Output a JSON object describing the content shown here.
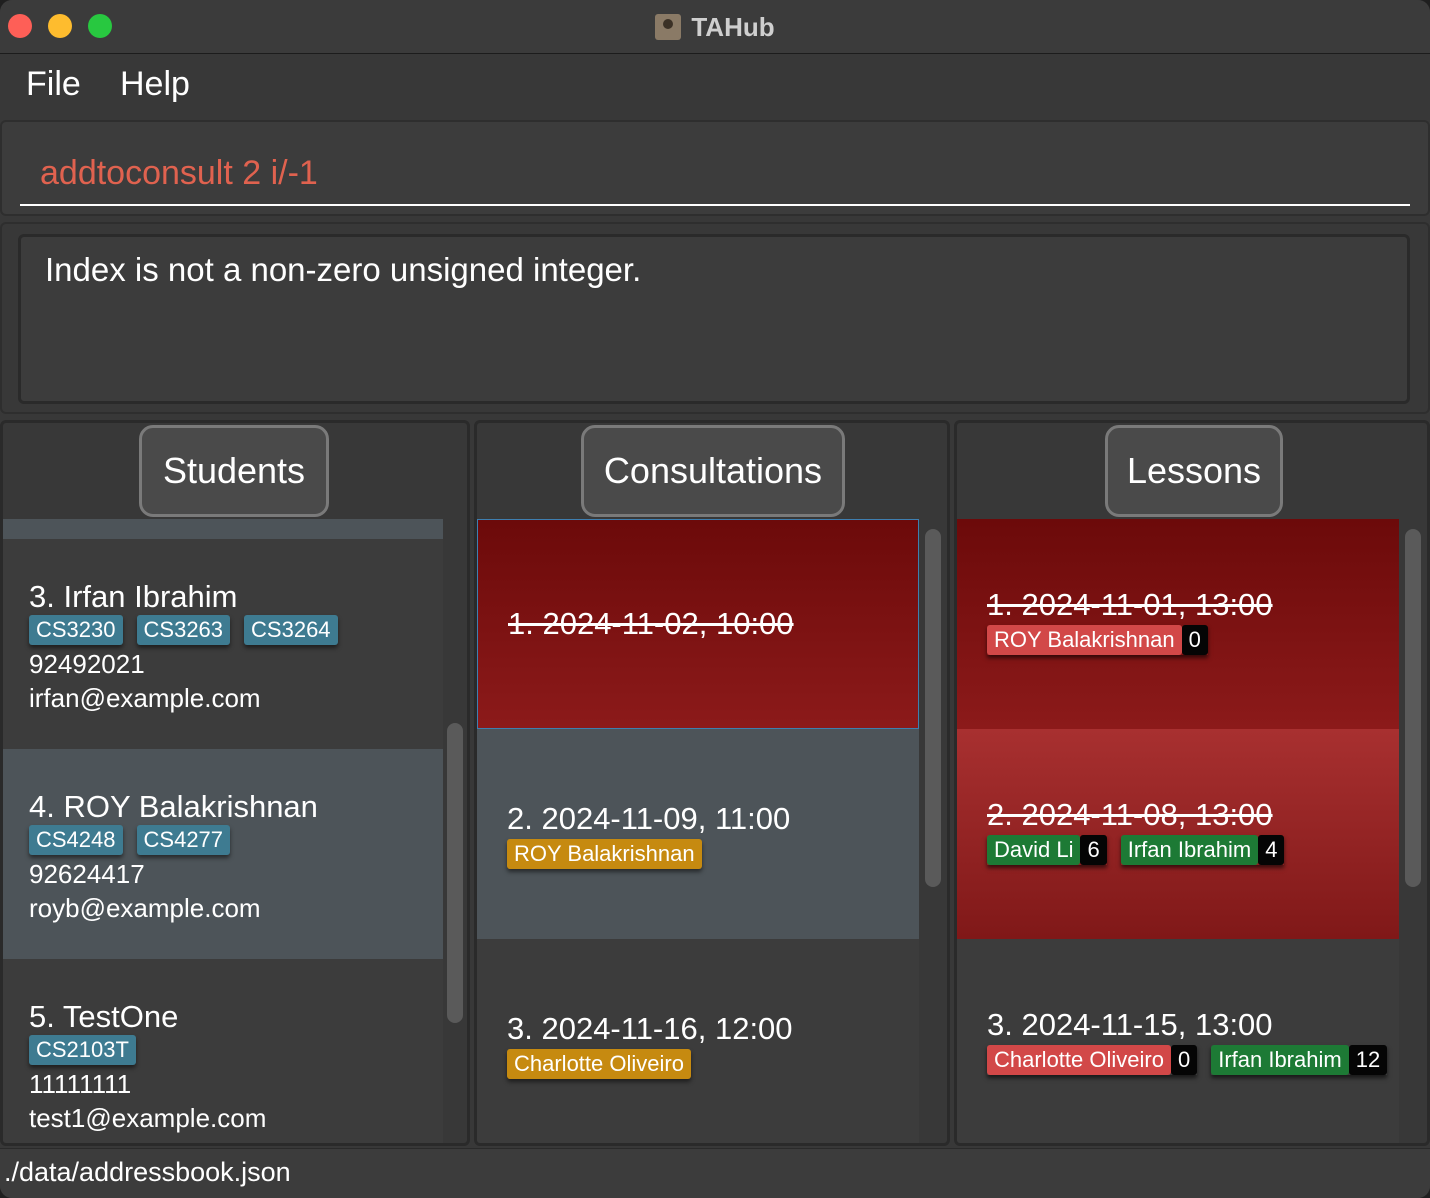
{
  "window": {
    "title": "TAHub"
  },
  "menu": {
    "file": "File",
    "help": "Help"
  },
  "command": {
    "value": "addtoconsult 2 i/-1"
  },
  "result": {
    "message": "Index is not a non-zero unsigned integer."
  },
  "panels": {
    "students": "Students",
    "consultations": "Consultations",
    "lessons": "Lessons"
  },
  "students": [
    {
      "name": "3. Irfan Ibrahim",
      "tags": [
        "CS3230",
        "CS3263",
        "CS3264"
      ],
      "phone": "92492021",
      "email": "irfan@example.com"
    },
    {
      "name": "4. ROY Balakrishnan",
      "tags": [
        "CS4248",
        "CS4277"
      ],
      "phone": "92624417",
      "email": "royb@example.com"
    },
    {
      "name": "5. TestOne",
      "tags": [
        "CS2103T"
      ],
      "phone": "11111111",
      "email": "test1@example.com"
    }
  ],
  "consultations": [
    {
      "when": "1. 2024-11-02, 10:00",
      "past": true,
      "students": []
    },
    {
      "when": "2. 2024-11-09, 11:00",
      "past": false,
      "students": [
        "ROY Balakrishnan"
      ]
    },
    {
      "when": "3. 2024-11-16, 12:00",
      "past": false,
      "students": [
        "Charlotte Oliveiro"
      ]
    }
  ],
  "lessons": [
    {
      "when": "1. 2024-11-01, 13:00",
      "past": true,
      "students": [
        {
          "name": "ROY Balakrishnan",
          "count": "0",
          "attended": false
        }
      ]
    },
    {
      "when": "2. 2024-11-08, 13:00",
      "past": true,
      "students": [
        {
          "name": "David Li",
          "count": "6",
          "attended": true
        },
        {
          "name": "Irfan Ibrahim",
          "count": "4",
          "attended": true
        }
      ]
    },
    {
      "when": "3. 2024-11-15, 13:00",
      "past": false,
      "students": [
        {
          "name": "Charlotte Oliveiro",
          "count": "0",
          "attended": false
        },
        {
          "name": "Irfan Ibrahim",
          "count": "12",
          "attended": true
        }
      ]
    }
  ],
  "status": {
    "path": "./data/addressbook.json"
  },
  "colors": {
    "accent_error": "#e0624f",
    "tag_module": "#3e7b91",
    "tag_consult": "#c68a10",
    "tag_absent": "#d24848",
    "tag_present": "#1d7a35",
    "past_card": "#7a1010"
  }
}
